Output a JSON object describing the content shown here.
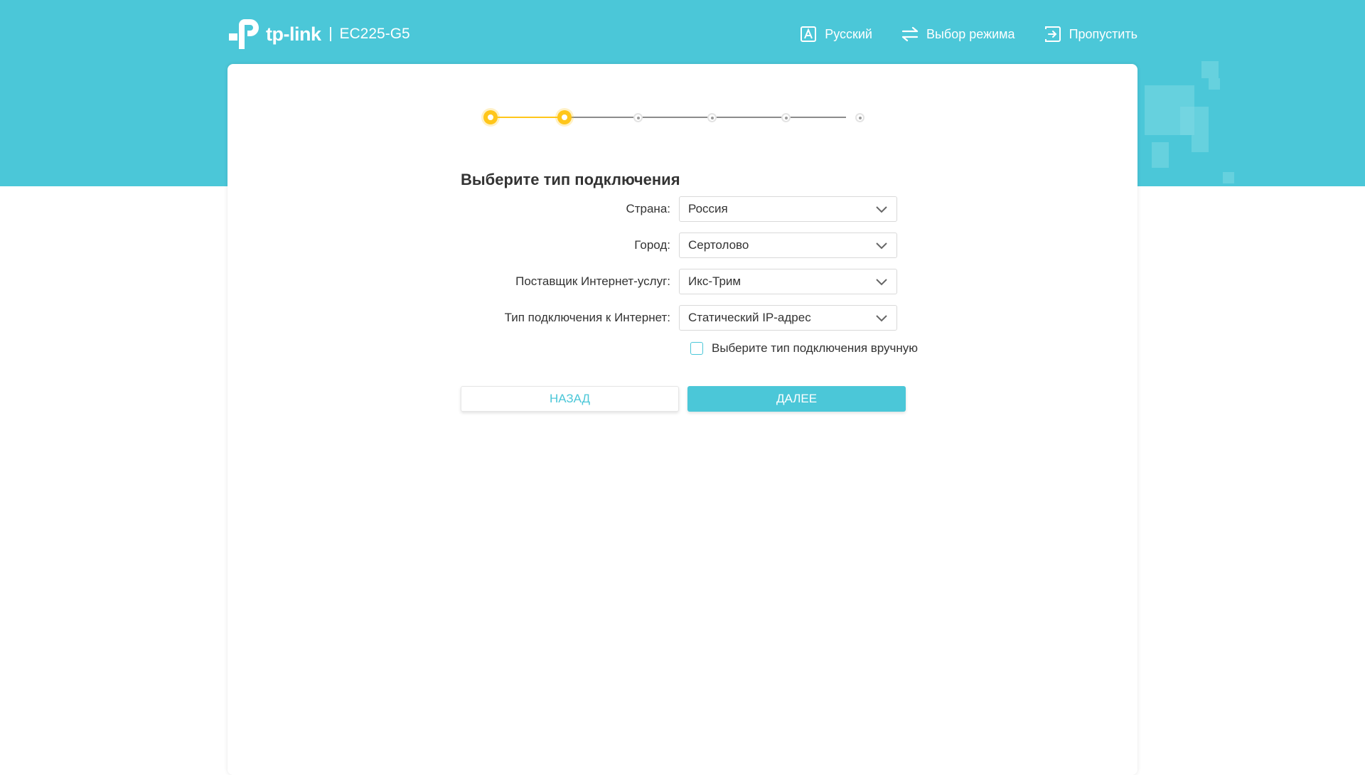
{
  "header": {
    "brand_text": "tp-link",
    "model": "EC225-G5",
    "nav": {
      "language_label": "Русский",
      "mode_label": "Выбор режима",
      "skip_label": "Пропустить"
    }
  },
  "stepper": {
    "total_steps": 6,
    "completed_steps": 2
  },
  "form": {
    "title": "Выберите тип подключения",
    "fields": [
      {
        "label": "Страна:",
        "value": "Россия"
      },
      {
        "label": "Город:",
        "value": "Сертолово"
      },
      {
        "label": "Поставщик Интернет-услуг:",
        "value": "Икс-Трим"
      },
      {
        "label": "Тип подключения к Интернет:",
        "value": "Статический IP-адрес"
      }
    ],
    "manual_checkbox_label": "Выберите тип подключения вручную",
    "manual_checked": false
  },
  "buttons": {
    "back_label": "НАЗАД",
    "next_label": "ДАЛЕЕ"
  },
  "colors": {
    "accent": "#4bc7d8",
    "step_active": "#ffc61a",
    "step_inactive": "#9a9a9a"
  },
  "icons": {
    "language": "language-icon",
    "mode": "switch-mode-icon",
    "skip": "skip-exit-icon",
    "dropdown": "chevron-down-icon"
  }
}
